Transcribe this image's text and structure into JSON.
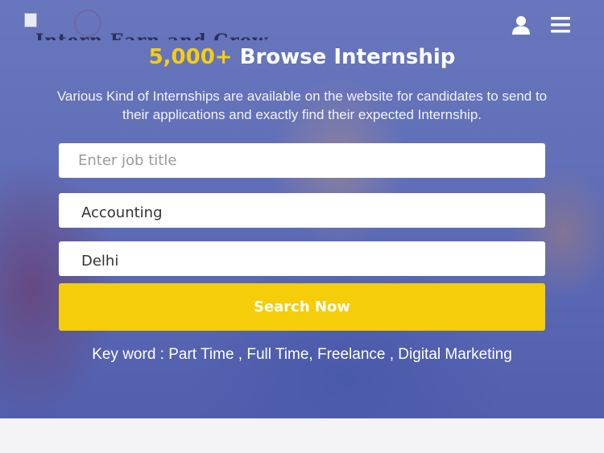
{
  "header": {
    "logo_text": "Intern Earn and Grow",
    "user_icon": "user-icon",
    "menu_icon": "hamburger-menu-icon"
  },
  "hero": {
    "headline_count": "5,000+",
    "headline_text": " Browse Internship",
    "intro": "Various Kind of Internships are available on the website for candidates to send to their applications and exactly find their expected Internship.",
    "keywords": "Key word : Part Time , Full Time, Freelance , Digital Marketing"
  },
  "search_form": {
    "job_title_placeholder": "Enter job title",
    "job_title_value": "",
    "category_value": "Accounting",
    "location_value": "Delhi",
    "submit_label": "Search Now"
  },
  "colors": {
    "accent": "#f5cd08",
    "overlay": "#5662b2"
  }
}
